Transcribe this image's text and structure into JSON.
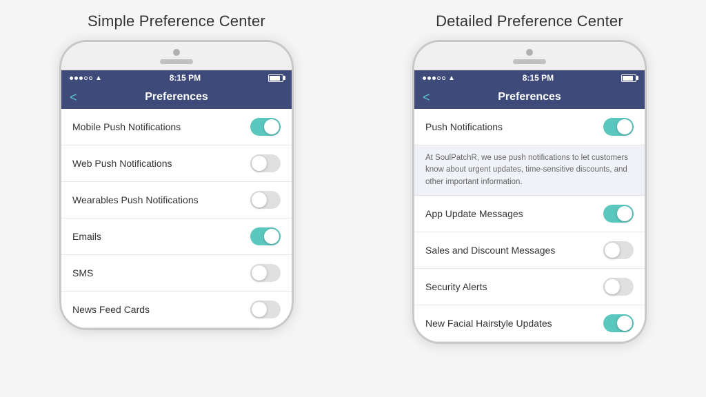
{
  "left_panel": {
    "title": "Simple Preference Center",
    "phone": {
      "status": {
        "time": "8:15 PM"
      },
      "nav": {
        "back": "<",
        "title": "Preferences"
      },
      "rows": [
        {
          "label": "Mobile Push Notifications",
          "on": true
        },
        {
          "label": "Web Push Notifications",
          "on": false
        },
        {
          "label": "Wearables Push Notifications",
          "on": false
        },
        {
          "label": "Emails",
          "on": true
        },
        {
          "label": "SMS",
          "on": false
        },
        {
          "label": "News Feed Cards",
          "on": false
        }
      ]
    }
  },
  "right_panel": {
    "title": "Detailed Preference Center",
    "phone": {
      "status": {
        "time": "8:15 PM"
      },
      "nav": {
        "back": "<",
        "title": "Preferences"
      },
      "main_toggle": {
        "label": "Push Notifications",
        "on": true
      },
      "description": "At SoulPatchR, we use push notifications to let customers know about urgent updates, time-sensitive discounts, and other important information.",
      "rows": [
        {
          "label": "App Update Messages",
          "on": true
        },
        {
          "label": "Sales and Discount Messages",
          "on": false
        },
        {
          "label": "Security Alerts",
          "on": false
        },
        {
          "label": "New Facial Hairstyle Updates",
          "on": true
        }
      ]
    }
  }
}
